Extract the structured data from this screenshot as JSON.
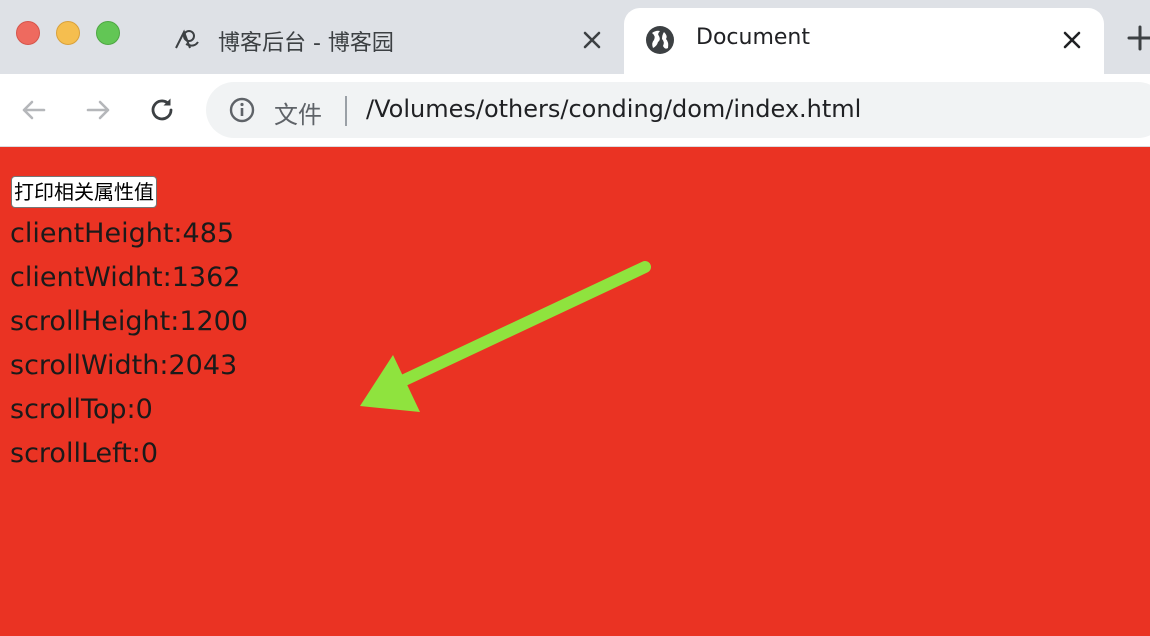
{
  "browser": {
    "tabs": [
      {
        "title": "博客后台 - 博客园",
        "favicon": "cnblogs-logo-icon",
        "active": false
      },
      {
        "title": "Document",
        "favicon": "globe-icon",
        "active": true
      }
    ],
    "new_tab_icon": "plus-icon"
  },
  "toolbar": {
    "security_label": "文件",
    "url": "/Volumes/others/conding/dom/index.html"
  },
  "page": {
    "background_color": "#ea3323",
    "button_label": "打印相关属性值",
    "metrics": [
      {
        "label": "clientHeight",
        "value": "485"
      },
      {
        "label": "clientWidht",
        "value": "1362"
      },
      {
        "label": "scrollHeight",
        "value": "1200"
      },
      {
        "label": "scrollWidth",
        "value": "2043"
      },
      {
        "label": "scrollTop",
        "value": "0"
      },
      {
        "label": "scrollLeft",
        "value": "0"
      }
    ],
    "annotation_arrow_color": "#8fe33e"
  }
}
